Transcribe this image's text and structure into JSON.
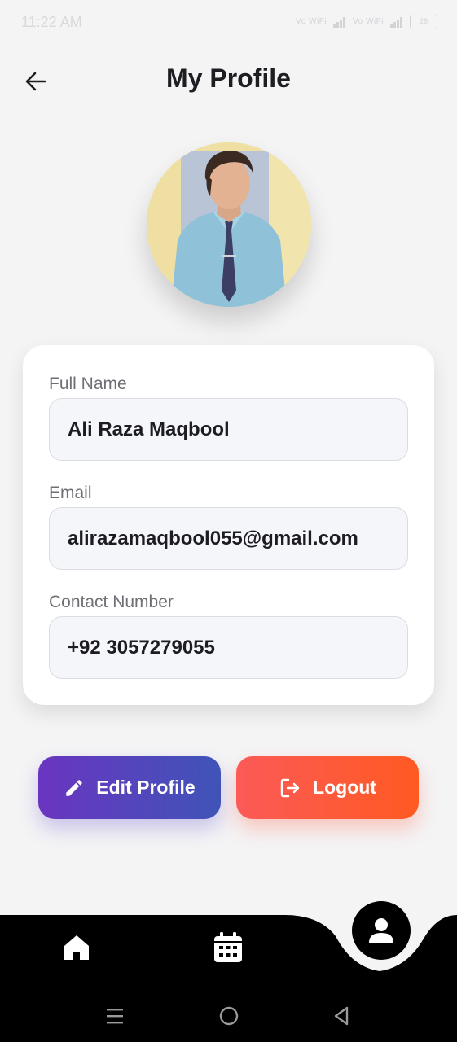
{
  "status_bar": {
    "time": "11:22 AM",
    "signal_1": "Vo WiFi",
    "signal_2": "Vo WiFi",
    "battery": "26"
  },
  "header": {
    "title": "My Profile"
  },
  "profile": {
    "fields": [
      {
        "label": "Full Name",
        "value": "Ali Raza Maqbool"
      },
      {
        "label": "Email",
        "value": "alirazamaqbool055@gmail.com"
      },
      {
        "label": "Contact Number",
        "value": "+92 3057279055"
      }
    ]
  },
  "actions": {
    "edit_label": "Edit Profile",
    "logout_label": "Logout"
  },
  "colors": {
    "edit_start": "#6a35c0",
    "edit_end": "#3f54b8",
    "logout_start": "#fb5a57",
    "logout_end": "#ff5a22",
    "nav_bg": "#000000"
  },
  "bottom_nav": {
    "items": [
      "home-icon",
      "calendar-icon",
      "profile-icon"
    ],
    "active": "profile-icon"
  }
}
